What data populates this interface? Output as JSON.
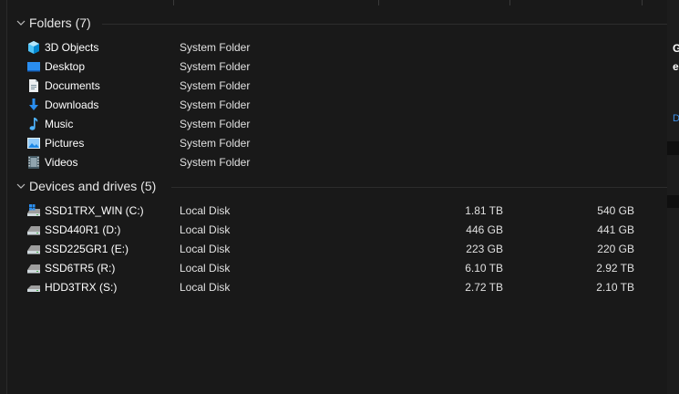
{
  "groups": {
    "folders": {
      "title": "Folders (7)"
    },
    "devices": {
      "title": "Devices and drives (5)"
    }
  },
  "folders": [
    {
      "name": "3D Objects",
      "type": "System Folder",
      "icon": "3d-objects-icon"
    },
    {
      "name": "Desktop",
      "type": "System Folder",
      "icon": "desktop-icon"
    },
    {
      "name": "Documents",
      "type": "System Folder",
      "icon": "documents-icon"
    },
    {
      "name": "Downloads",
      "type": "System Folder",
      "icon": "downloads-icon"
    },
    {
      "name": "Music",
      "type": "System Folder",
      "icon": "music-icon"
    },
    {
      "name": "Pictures",
      "type": "System Folder",
      "icon": "pictures-icon"
    },
    {
      "name": "Videos",
      "type": "System Folder",
      "icon": "videos-icon"
    }
  ],
  "drives": [
    {
      "name": "SSD1TRX_WIN (C:)",
      "type": "Local Disk",
      "total": "1.81 TB",
      "free": "540 GB",
      "icon": "windows-drive-icon"
    },
    {
      "name": "SSD440R1 (D:)",
      "type": "Local Disk",
      "total": "446 GB",
      "free": "441 GB",
      "icon": "drive-icon"
    },
    {
      "name": "SSD225GR1 (E:)",
      "type": "Local Disk",
      "total": "223 GB",
      "free": "220 GB",
      "icon": "drive-icon"
    },
    {
      "name": "SSD6TR5 (R:)",
      "type": "Local Disk",
      "total": "6.10 TB",
      "free": "2.92 TB",
      "icon": "drive-icon"
    },
    {
      "name": "HDD3TRX (S:)",
      "type": "Local Disk",
      "total": "2.72 TB",
      "free": "2.10 TB",
      "icon": "drive-icon"
    }
  ],
  "colors": {
    "background": "#191919",
    "text": "#ffffff",
    "secondary_text": "#e0e0e0",
    "folder_accent": "#2a8ef0"
  }
}
